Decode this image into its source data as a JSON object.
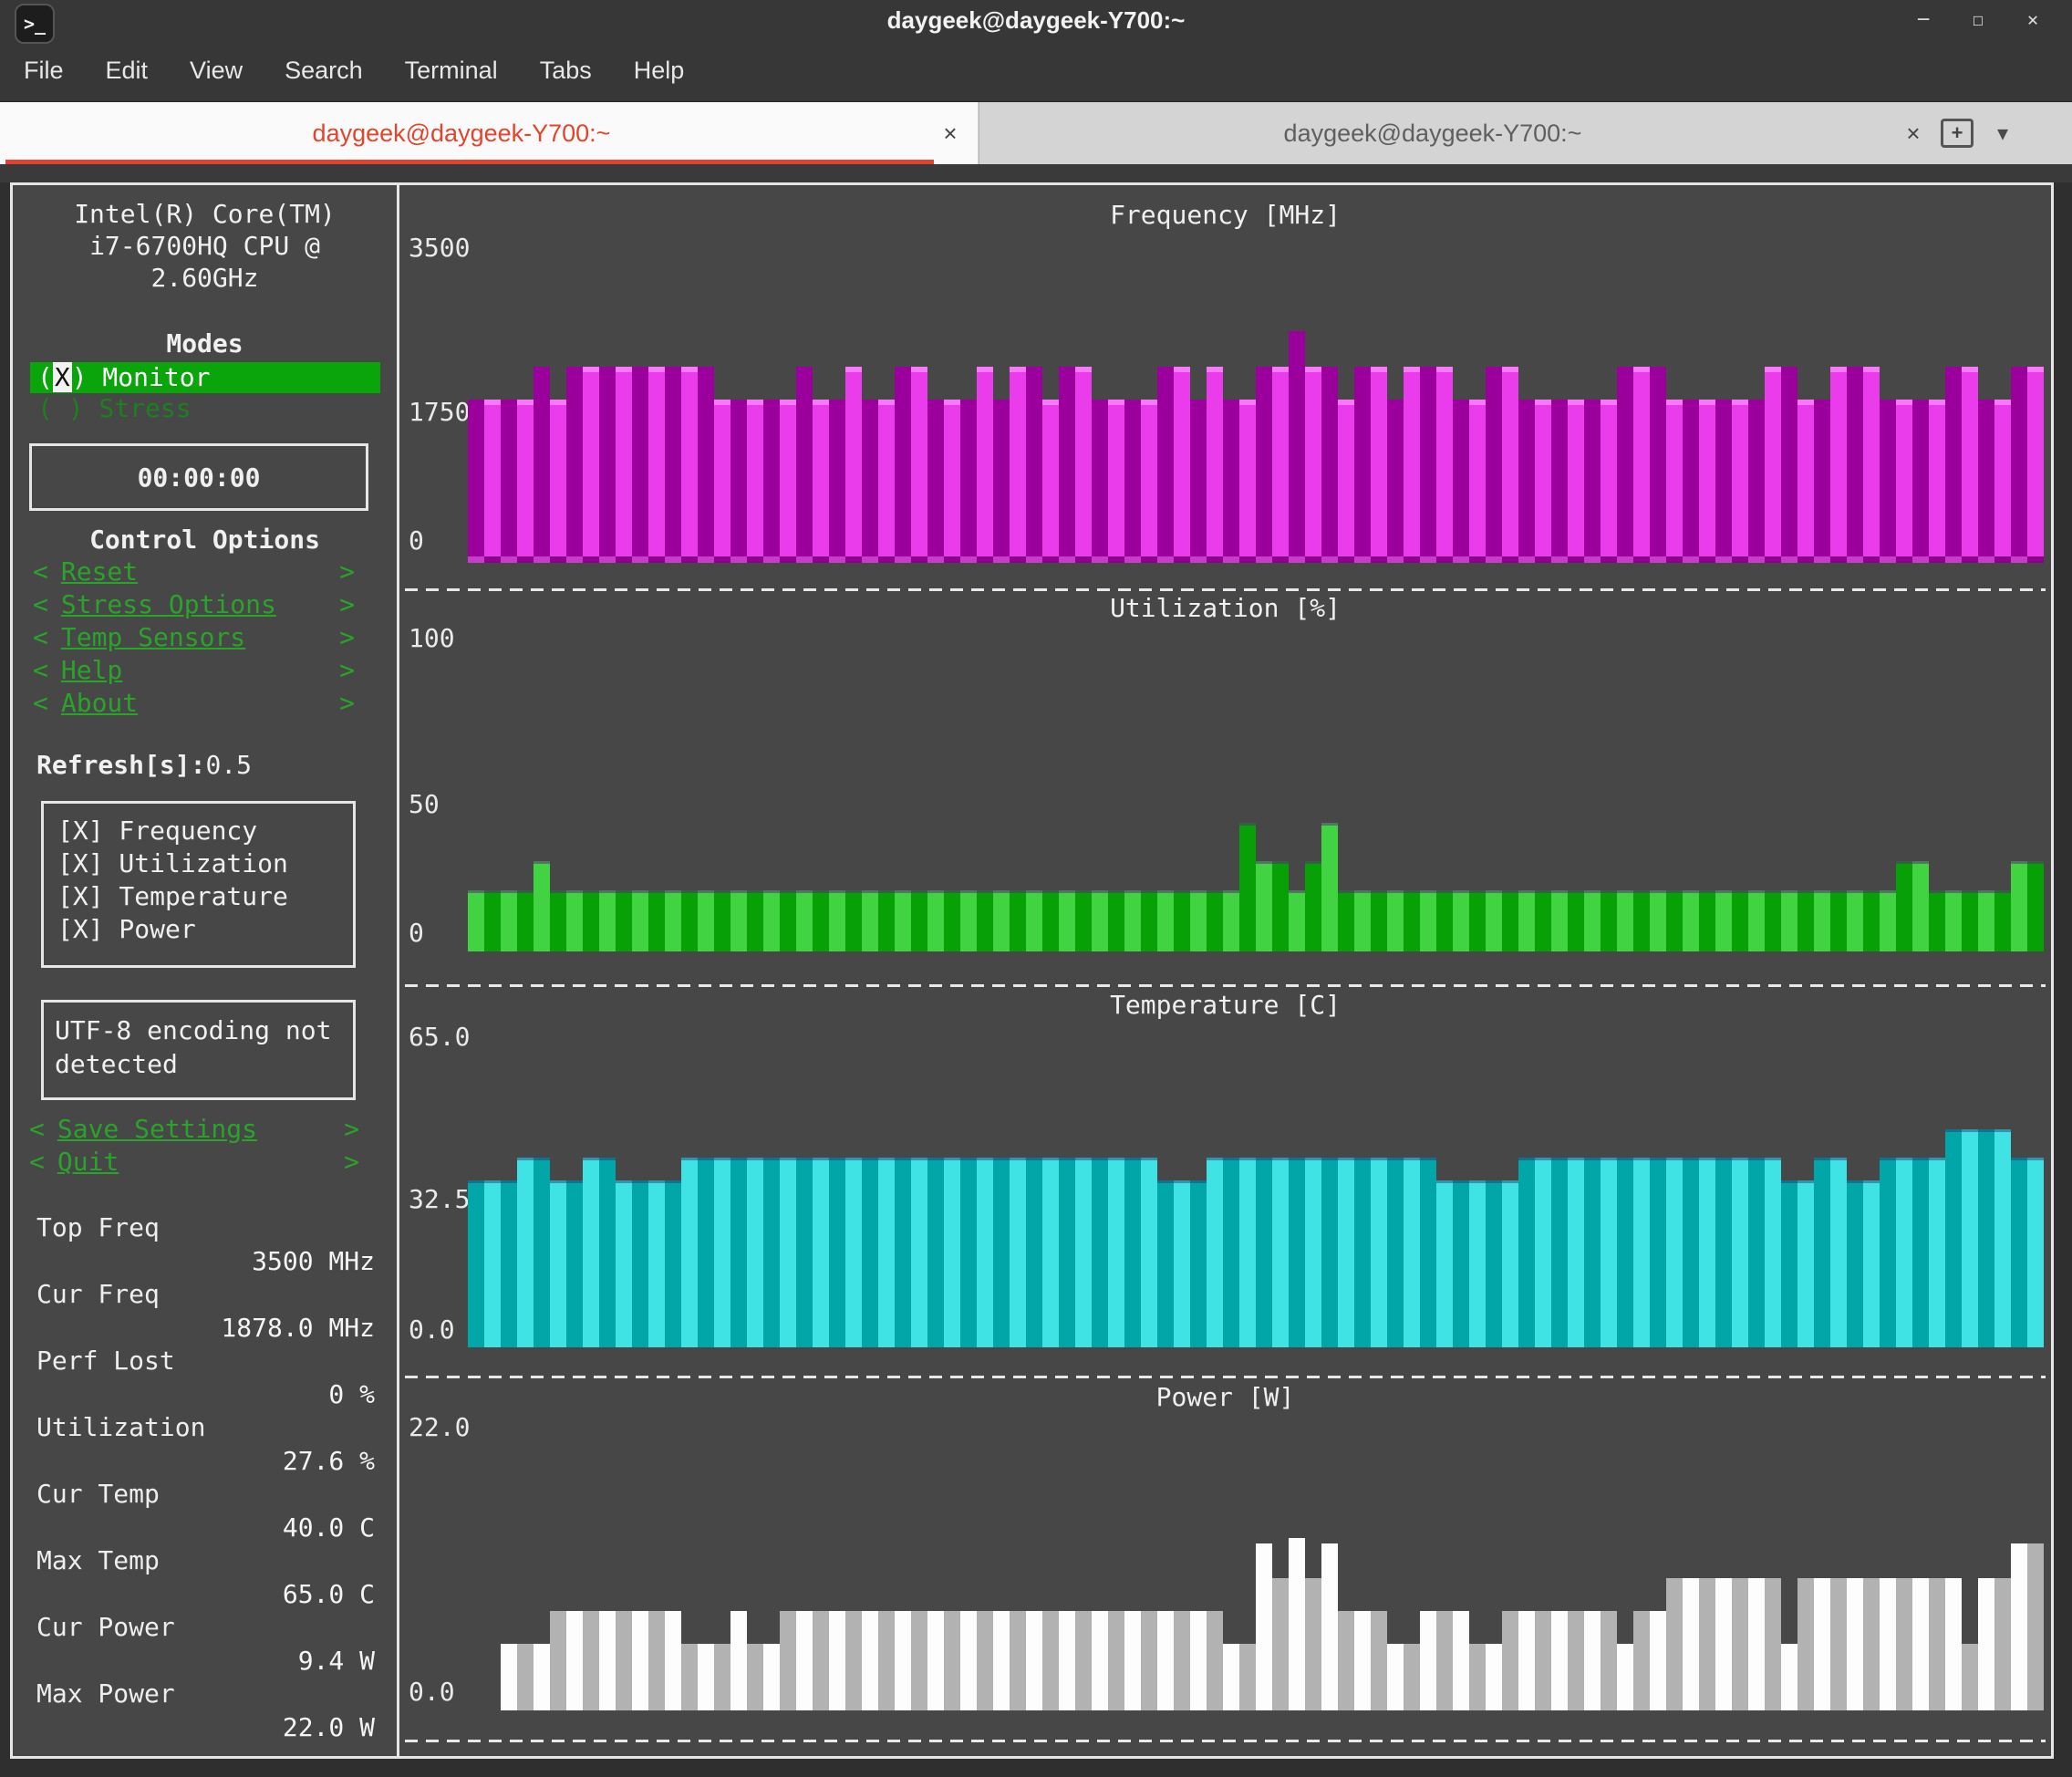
{
  "window": {
    "title": "daygeek@daygeek-Y700:~",
    "controls": {
      "minimize": "─",
      "maximize": "☐",
      "close": "✕"
    }
  },
  "menu_bar": {
    "items": [
      "File",
      "Edit",
      "View",
      "Search",
      "Terminal",
      "Tabs",
      "Help"
    ]
  },
  "tabs": {
    "close_glyph": "×",
    "new_tab_glyph": "+",
    "menu_glyph": "▼",
    "active": {
      "label": "daygeek@daygeek-Y700:~"
    },
    "inactive": {
      "label": "daygeek@daygeek-Y700:~"
    }
  },
  "sidebar": {
    "cpu_lines": [
      "Intel(R) Core(TM)",
      "i7-6700HQ CPU @",
      "2.60GHz"
    ],
    "modes": {
      "heading": "Modes",
      "options": [
        {
          "label": "Monitor",
          "selected": true
        },
        {
          "label": "Stress",
          "selected": false
        }
      ]
    },
    "timer": "00:00:00",
    "control_options": {
      "heading": "Control Options",
      "buttons": [
        "Reset",
        "Stress Options",
        "Temp Sensors",
        "Help",
        "About"
      ]
    },
    "refresh": {
      "label": "Refresh[s]:",
      "value": "0.5"
    },
    "graph_toggles": [
      {
        "mark": "[X]",
        "label": "Frequency"
      },
      {
        "mark": "[X]",
        "label": "Utilization"
      },
      {
        "mark": "[X]",
        "label": "Temperature"
      },
      {
        "mark": "[X]",
        "label": "Power"
      }
    ],
    "encoding_warning": "UTF-8 encoding not detected",
    "footer_buttons": [
      "Save Settings",
      "Quit"
    ],
    "stats": [
      {
        "label": "Top Freq",
        "value": "3500 MHz"
      },
      {
        "label": "Cur Freq",
        "value": "1878.0 MHz"
      },
      {
        "label": "Perf Lost",
        "value": "0 %"
      },
      {
        "label": "Utilization",
        "value": "27.6 %"
      },
      {
        "label": "Cur Temp",
        "value": "40.0 C"
      },
      {
        "label": "Max Temp",
        "value": "65.0 C"
      },
      {
        "label": "Cur Power",
        "value": "9.4 W"
      },
      {
        "label": "Max Power",
        "value": "22.0 W"
      }
    ]
  },
  "chart_data": [
    {
      "id": "frequency",
      "type": "bar",
      "title": "Frequency [MHz]",
      "ylabel_ticks": [
        "3500",
        "1750",
        "0"
      ],
      "ylim": [
        0,
        3500
      ],
      "unit": "MHz",
      "legend_position": "none",
      "grid": false,
      "color_bright": "#ea3cea",
      "color_dark": "#9c009c",
      "start_dark": true,
      "values": [
        1878,
        1878,
        1878,
        1878,
        2280,
        1878,
        2280,
        2280,
        2280,
        2280,
        2280,
        2280,
        2280,
        2280,
        2280,
        1878,
        1878,
        1878,
        1878,
        1878,
        2280,
        1878,
        1878,
        2280,
        1878,
        1878,
        2280,
        2280,
        1878,
        1878,
        1878,
        2280,
        1878,
        2280,
        2280,
        1878,
        2280,
        2280,
        1878,
        1878,
        1878,
        1878,
        2280,
        2280,
        1878,
        2280,
        1878,
        1878,
        2280,
        2280,
        2700,
        2280,
        2280,
        1878,
        2280,
        2280,
        1878,
        2280,
        2280,
        2280,
        1878,
        1878,
        2280,
        2280,
        1878,
        1878,
        1878,
        1878,
        1878,
        1878,
        2280,
        2280,
        2280,
        1878,
        1878,
        1878,
        1878,
        1878,
        1878,
        2280,
        2280,
        1878,
        1878,
        2280,
        2280,
        2280,
        1878,
        1878,
        1878,
        1878,
        2280,
        2280,
        1878,
        1878,
        2280,
        2280
      ]
    },
    {
      "id": "utilization",
      "type": "bar",
      "title": "Utilization [%]",
      "ylabel_ticks": [
        "100",
        "50",
        "0"
      ],
      "ylim": [
        0,
        100
      ],
      "unit": "%",
      "legend_position": "none",
      "grid": false,
      "color_bright": "#41d341",
      "color_dark": "#07a007",
      "start_dark": false,
      "values": [
        21,
        21,
        21,
        21,
        31,
        21,
        21,
        21,
        21,
        21,
        21,
        21,
        21,
        21,
        21,
        21,
        21,
        21,
        21,
        21,
        21,
        21,
        21,
        21,
        21,
        21,
        21,
        21,
        21,
        21,
        21,
        21,
        21,
        21,
        21,
        21,
        21,
        21,
        21,
        21,
        21,
        21,
        21,
        21,
        21,
        21,
        21,
        44,
        31,
        31,
        21,
        31,
        44,
        21,
        21,
        21,
        21,
        21,
        21,
        21,
        21,
        21,
        21,
        21,
        21,
        21,
        21,
        21,
        21,
        21,
        21,
        21,
        21,
        21,
        21,
        21,
        21,
        21,
        21,
        21,
        21,
        21,
        21,
        21,
        21,
        21,
        21,
        31,
        31,
        21,
        21,
        21,
        21,
        21,
        31,
        31
      ]
    },
    {
      "id": "temperature",
      "type": "bar",
      "title": "Temperature [C]",
      "ylabel_ticks": [
        "65.0",
        "32.5",
        "0.0"
      ],
      "ylim": [
        0,
        65
      ],
      "unit": "C",
      "legend_position": "none",
      "grid": false,
      "color_bright": "#3fe3e3",
      "color_dark": "#00a6a8",
      "start_dark": true,
      "values": [
        36,
        36,
        36,
        41,
        41,
        36,
        36,
        41,
        41,
        36,
        36,
        36,
        36,
        41,
        41,
        41,
        41,
        41,
        41,
        41,
        41,
        41,
        41,
        41,
        41,
        41,
        41,
        41,
        41,
        41,
        41,
        41,
        41,
        41,
        41,
        41,
        41,
        41,
        41,
        41,
        41,
        41,
        36,
        36,
        36,
        41,
        41,
        41,
        41,
        41,
        41,
        41,
        41,
        41,
        41,
        41,
        41,
        41,
        41,
        36,
        36,
        36,
        36,
        36,
        41,
        41,
        41,
        41,
        41,
        41,
        41,
        41,
        41,
        41,
        41,
        41,
        41,
        41,
        41,
        41,
        36,
        36,
        41,
        41,
        36,
        36,
        41,
        41,
        41,
        41,
        47,
        47,
        47,
        47,
        41,
        41
      ]
    },
    {
      "id": "power",
      "type": "bar",
      "title": "Power [W]",
      "ylabel_ticks": [
        "22.0",
        "0.0"
      ],
      "ylim": [
        0,
        22
      ],
      "unit": "W",
      "legend_position": "none",
      "grid": false,
      "color_bright": "#fdfdfd",
      "color_dark": "#b2b2b2",
      "start_dark": false,
      "values": [
        0,
        0,
        5,
        5,
        5,
        7.5,
        7.5,
        7.5,
        7.5,
        7.5,
        7.5,
        7.5,
        7.5,
        5,
        5,
        5,
        7.5,
        5,
        5,
        7.5,
        7.5,
        7.5,
        7.5,
        7.5,
        7.5,
        7.5,
        7.5,
        7.5,
        7.5,
        7.5,
        7.5,
        7.5,
        7.5,
        7.5,
        7.5,
        7.5,
        7.5,
        7.5,
        7.5,
        7.5,
        7.5,
        7.5,
        7.5,
        7.5,
        7.5,
        7.5,
        5,
        5,
        12.6,
        10,
        13,
        10,
        12.6,
        7.5,
        7.5,
        7.5,
        5,
        5,
        7.5,
        7.5,
        7.5,
        5,
        5,
        7.5,
        7.5,
        7.5,
        7.5,
        7.5,
        7.5,
        7.5,
        5,
        7.5,
        7.5,
        10,
        10,
        10,
        10,
        10,
        10,
        10,
        5,
        10,
        10,
        10,
        10,
        10,
        10,
        10,
        10,
        10,
        10,
        5,
        10,
        10,
        12.6,
        12.6
      ]
    }
  ]
}
